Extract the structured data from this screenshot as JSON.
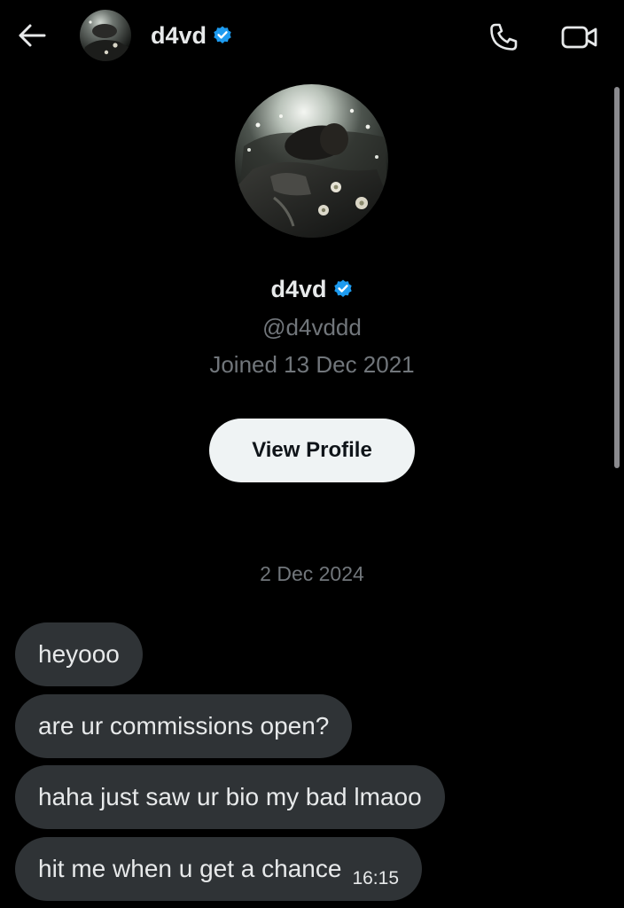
{
  "header": {
    "back_icon": "arrow-left-icon",
    "name": "d4vd",
    "verified_icon": "verified-badge-icon",
    "call_icon": "phone-icon",
    "video_icon": "video-camera-icon"
  },
  "profile": {
    "name": "d4vd",
    "handle": "@d4vddd",
    "joined": "Joined 13 Dec 2021",
    "view_profile_label": "View Profile"
  },
  "conversation": {
    "date": "2 Dec 2024",
    "messages": [
      {
        "text": "heyooo"
      },
      {
        "text": "are ur commissions open?"
      },
      {
        "text": "haha just saw ur bio my bad lmaoo"
      },
      {
        "text": "hit me when u get a chance",
        "time": "16:15"
      }
    ]
  },
  "colors": {
    "background": "#000000",
    "bubble": "#2f3336",
    "verified": "#1d9bf0",
    "secondary_text": "#71767b",
    "button_bg": "#eff3f4"
  }
}
